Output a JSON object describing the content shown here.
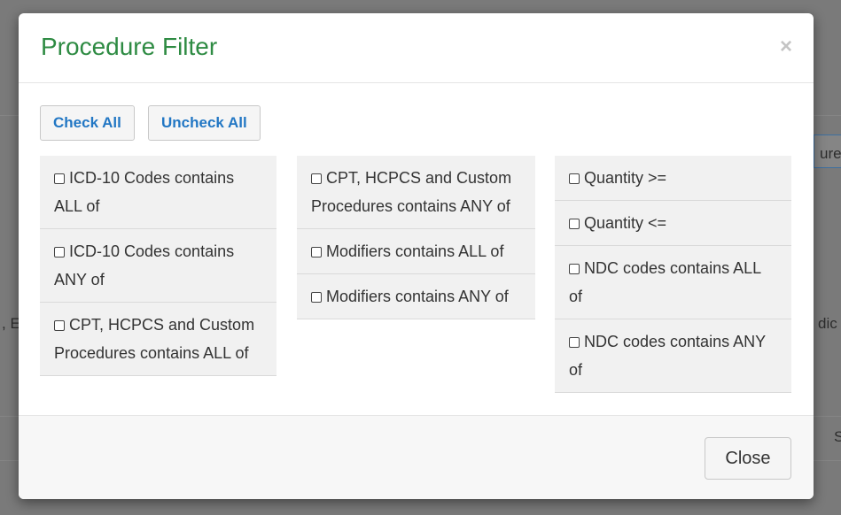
{
  "background": {
    "fragment_right_top": "ure",
    "fragment_right_mid": "dic",
    "fragment_left_mid": ", E",
    "fragment_right_bottom": "S"
  },
  "modal": {
    "title": "Procedure Filter",
    "close_glyph": "×",
    "check_all_label": "Check All",
    "uncheck_all_label": "Uncheck All",
    "columns": [
      [
        "ICD-10 Codes contains ALL of",
        "ICD-10 Codes contains ANY of",
        "CPT, HCPCS and Custom Procedures contains ALL of"
      ],
      [
        "CPT, HCPCS and Custom Procedures contains ANY of",
        "Modifiers contains ALL of",
        "Modifiers contains ANY of"
      ],
      [
        "Quantity >=",
        "Quantity <=",
        "NDC codes contains ALL of",
        "NDC codes contains ANY of"
      ]
    ],
    "footer_close_label": "Close"
  },
  "colors": {
    "title": "#2e8b43",
    "link_button": "#2277c4",
    "overlay": "#7a7a7a"
  }
}
